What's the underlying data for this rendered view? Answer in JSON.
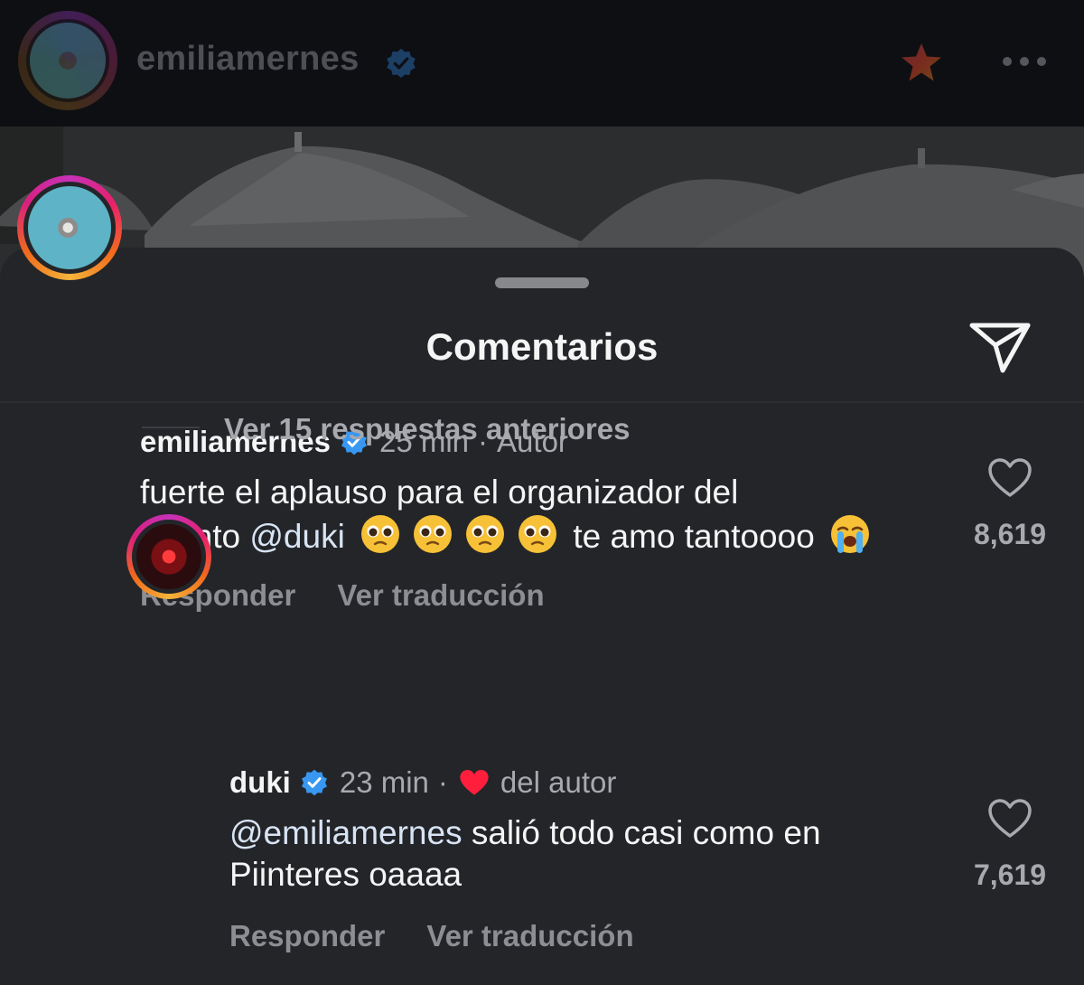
{
  "post": {
    "username": "emiliamernes",
    "verified_icon": "verified-badge-icon",
    "favorite_icon": "star-icon",
    "more_icon": "more-options-icon"
  },
  "sheet": {
    "title": "Comentarios",
    "share_icon": "send-icon"
  },
  "comments": [
    {
      "username": "emiliamernes",
      "time": "25 min",
      "separator": "·",
      "tag": "Autor",
      "text_line1": "fuerte el aplauso para el organizador del",
      "text_line2_prefix": "evento",
      "mention": "@duki",
      "emoji_pleading": "🥺",
      "text_line2_suffix": "te amo tantoooo",
      "emoji_crying": "😭",
      "like_count": "8,619",
      "reply_label": "Responder",
      "translate_label": "Ver traducción"
    }
  ],
  "replies_toggle": "Ver 15 respuestas anteriores",
  "replies": [
    {
      "username": "duki",
      "time": "23 min",
      "separator": "·",
      "liked_label": "del autor",
      "mention": "@emiliamernes",
      "text_line1_suffix": "salió todo casi como en",
      "text_line2": "Piinteres oaaaa",
      "like_count": "7,619",
      "reply_label": "Responder",
      "translate_label": "Ver traducción"
    }
  ],
  "colors": {
    "sheet_bg": "#232529",
    "verified_blue": "#3897f0",
    "heart_red": "#ff1f3d"
  }
}
